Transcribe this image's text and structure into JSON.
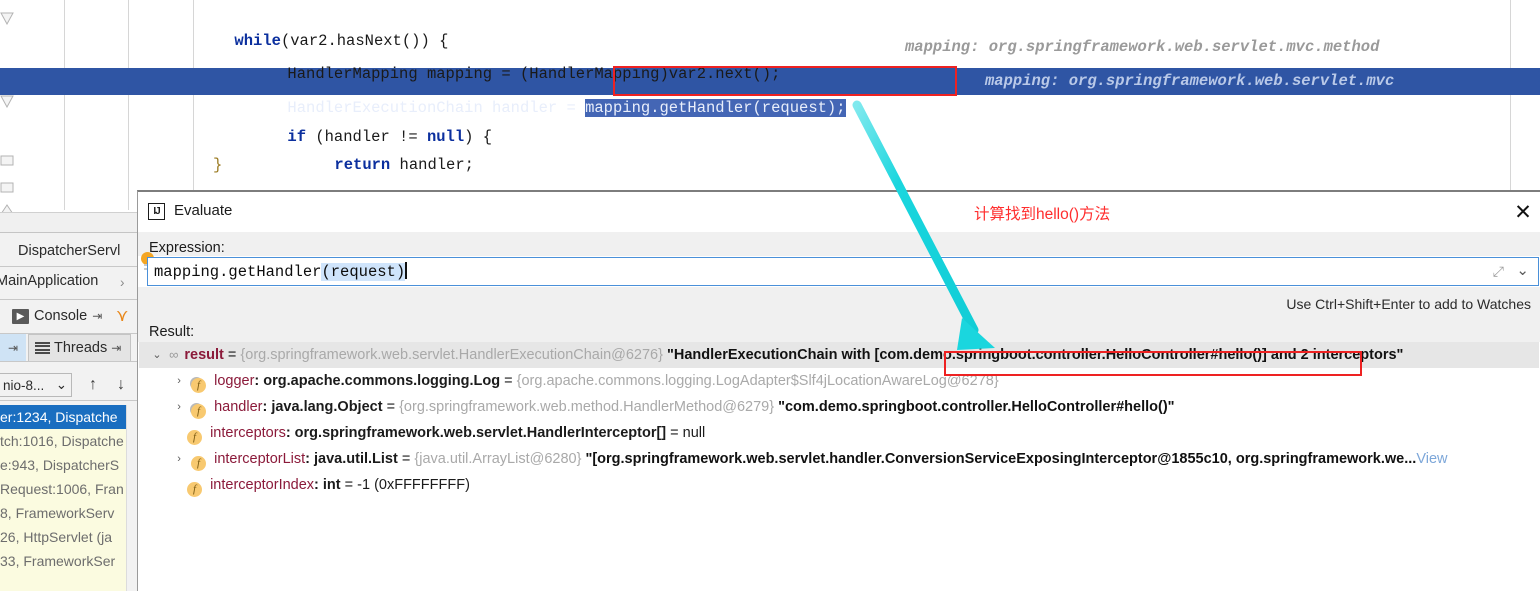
{
  "editor": {
    "lines": [
      {
        "indent": 160,
        "segments": [
          {
            "text": "while",
            "style": "kw"
          },
          {
            "text": "(var2.hasNext()) {",
            "style": "plain"
          }
        ],
        "hint": ""
      },
      {
        "indent": 213,
        "segments": [
          {
            "text": "HandlerMapping mapping = (HandlerMapping)var2.next();",
            "style": "plain"
          }
        ],
        "hint": "mapping: org.springframework.web.servlet.mvc.method"
      },
      {
        "indent": 213,
        "segments": [
          {
            "text": "HandlerExecutionChain handler = ",
            "style": "plain"
          },
          {
            "text": "mapping.getHandler(request);",
            "style": "sel"
          }
        ],
        "hint": "mapping: org.springframework.web.servlet.mvc"
      },
      {
        "indent": 213,
        "segments": [
          {
            "text": "if",
            "style": "kw"
          },
          {
            "text": " (handler != ",
            "style": "plain"
          },
          {
            "text": "null",
            "style": "kw"
          },
          {
            "text": ") {",
            "style": "plain"
          }
        ],
        "hint": ""
      },
      {
        "indent": 260,
        "segments": [
          {
            "text": "return",
            "style": "kw"
          },
          {
            "text": " handler;",
            "style": "plain"
          }
        ],
        "hint": ""
      },
      {
        "indent": 213,
        "segments": [
          {
            "text": "}",
            "style": "brace"
          }
        ],
        "hint": ""
      },
      {
        "indent": 160,
        "segments": [
          {
            "text": "}",
            "style": "brace"
          }
        ],
        "hint": ""
      }
    ]
  },
  "left_panel": {
    "tab_dispatcher": "DispatcherServl",
    "tab_main_app": "MainApplication",
    "console_label": "Console",
    "threads_label": "Threads",
    "thread_combo": "nio-8...",
    "frames": [
      {
        "text": "er:1234, Dispatche",
        "selected": true
      },
      {
        "text": "tch:1016, Dispatche",
        "selected": false
      },
      {
        "text": "e:943, DispatcherS",
        "selected": false
      },
      {
        "text": "Request:1006, Fran",
        "selected": false
      },
      {
        "text": "8, FrameworkServ",
        "selected": false
      },
      {
        "text": "26, HttpServlet (ja",
        "selected": false
      },
      {
        "text": "33, FrameworkSer",
        "selected": false
      }
    ]
  },
  "dialog": {
    "icon_text": "IJ",
    "title": "Evaluate",
    "annotation": "计算找到hello()方法",
    "close_label": "✕",
    "expression_label": "Expression:",
    "expression_prefix": "mapping.getHandler",
    "expression_highlight": "(request)",
    "watch_hint": "Use Ctrl+Shift+Enter to add to Watches",
    "result_label": "Result:",
    "expand_icon": "⤢",
    "chevron_icon": "⌄"
  },
  "result_tree": [
    {
      "twist": "⌄",
      "icon": "oo",
      "indent": 0,
      "selected": true,
      "name": "result",
      "eq": " = ",
      "ref": "{org.springframework.web.servlet.HandlerExecutionChain@6276}",
      "str_before": " \"HandlerExecutionChain with ",
      "boxed": "[com.demo.springboot.controller.HelloController#hello()]",
      "str_after": " and 2 interceptors\"",
      "type": "",
      "value": "",
      "view": ""
    },
    {
      "twist": "›",
      "icon": "f-key",
      "indent": 1,
      "selected": false,
      "name": "logger",
      "type": ": org.apache.commons.logging.Log",
      "eq": "  = ",
      "ref": "{org.apache.commons.logging.LogAdapter$Slf4jLocationAwareLog@6278}",
      "value": "",
      "view": ""
    },
    {
      "twist": "›",
      "icon": "f-key",
      "indent": 1,
      "selected": false,
      "name": "handler",
      "type": ": java.lang.Object",
      "eq": "  = ",
      "ref": "{org.springframework.web.method.HandlerMethod@6279}",
      "value": " \"com.demo.springboot.controller.HelloController#hello()\"",
      "view": ""
    },
    {
      "twist": "",
      "icon": "f",
      "indent": 1,
      "selected": false,
      "name": "interceptors",
      "type": ": org.springframework.web.servlet.HandlerInterceptor[]",
      "eq": "  = ",
      "ref": "",
      "value": "null",
      "view": ""
    },
    {
      "twist": "›",
      "icon": "f",
      "indent": 1,
      "selected": false,
      "name": "interceptorList",
      "type": ": java.util.List",
      "eq": "  = ",
      "ref": "{java.util.ArrayList@6280}",
      "value": " \"[org.springframework.web.servlet.handler.ConversionServiceExposingInterceptor@1855c10, org.springframework.we...",
      "view": "View"
    },
    {
      "twist": "",
      "icon": "f",
      "indent": 1,
      "selected": false,
      "name": "interceptorIndex",
      "type": ": int",
      "eq": "  = ",
      "ref": "",
      "value": "-1 (0xFFFFFFFF)",
      "view": ""
    }
  ],
  "colors": {
    "selection_blue": "#2f55a4",
    "annotation_red": "#ff2e2e",
    "highlight_box_red": "#ee2222",
    "arrow_cyan": "#1ad6de",
    "frames_yellow": "#fbfbe0",
    "field_icon_orange": "#f8c970"
  }
}
